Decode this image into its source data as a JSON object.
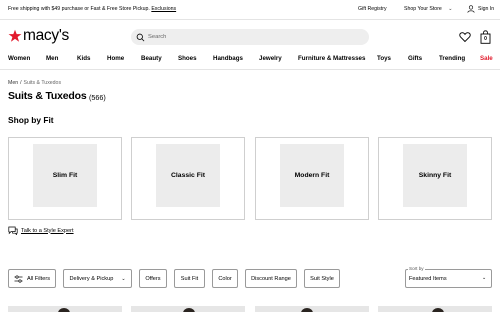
{
  "promo": {
    "text": "Free shipping with $49 purchase or Fast & Free Store Pickup.",
    "link": "Exclusions",
    "gift_registry": "Gift Registry",
    "your_store": "Your Store",
    "shop": "Shop",
    "sign_in": "Sign In"
  },
  "header": {
    "logo_text": "macy's",
    "search_placeholder": "Search",
    "bag_count": "0"
  },
  "nav": [
    "Women",
    "Men",
    "Kids",
    "Home",
    "Beauty",
    "Shoes",
    "Handbags",
    "Jewelry",
    "Furniture & Mattresses",
    "Toys",
    "Gifts",
    "Trending",
    "Sale"
  ],
  "breadcrumb": [
    "Men",
    "Suits & Tuxedos"
  ],
  "page": {
    "title": "Suits & Tuxedos",
    "count": "(566)",
    "section": "Shop by Fit"
  },
  "fits": [
    "Slim Fit",
    "Classic Fit",
    "Modern Fit",
    "Skinny Fit"
  ],
  "expert_link": "Talk to a Style Expert",
  "filters": {
    "all_filters": "All Filters",
    "delivery": "Delivery & Pickup",
    "offers": "Offers",
    "suit_fit": "Suit Fit",
    "color": "Color",
    "discount": "Discount Range",
    "suit_style": "Suit Style"
  },
  "sort": {
    "label": "Sort by",
    "value": "Featured Items"
  },
  "colors": {
    "brand_red": "#e21a2c",
    "border": "#cfcfcf",
    "card_fill": "#ececec"
  }
}
